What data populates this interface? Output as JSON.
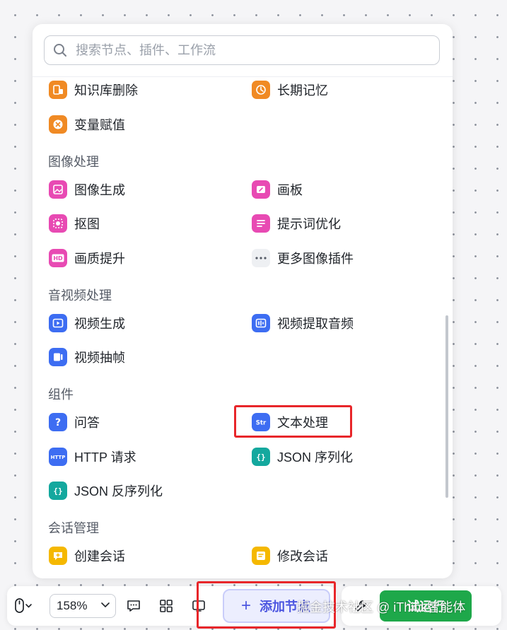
{
  "search": {
    "placeholder": "搜索节点、插件、工作流"
  },
  "sections": {
    "image": "图像处理",
    "video": "音视频处理",
    "components": "组件",
    "conversation": "会话管理"
  },
  "items": {
    "kb_delete": "知识库删除",
    "long_memory": "长期记忆",
    "var_assign": "变量赋值",
    "image_gen": "图像生成",
    "canvas": "画板",
    "matting": "抠图",
    "prompt_opt": "提示词优化",
    "quality_up": "画质提升",
    "more_image": "更多图像插件",
    "video_gen": "视频生成",
    "video_audio": "视频提取音频",
    "video_frame": "视频抽帧",
    "qa": "问答",
    "text_proc": "文本处理",
    "http": "HTTP 请求",
    "json_ser": "JSON 序列化",
    "json_deser": "JSON 反序列化",
    "create_conv": "创建会话",
    "edit_conv": "修改会话"
  },
  "toolbar": {
    "zoom": "158%",
    "add_node": "添加节点",
    "run": "试运行"
  },
  "watermark": "掘金技术社区 @ iThink智能体",
  "colors": {
    "orange": "#f08a24",
    "pink": "#e84ab3",
    "blue": "#3d6df2",
    "teal": "#14a89e",
    "yellow": "#f5b800",
    "highlight": "#e8262a",
    "run_green": "#1ea84a",
    "accent": "#4c56e0"
  }
}
